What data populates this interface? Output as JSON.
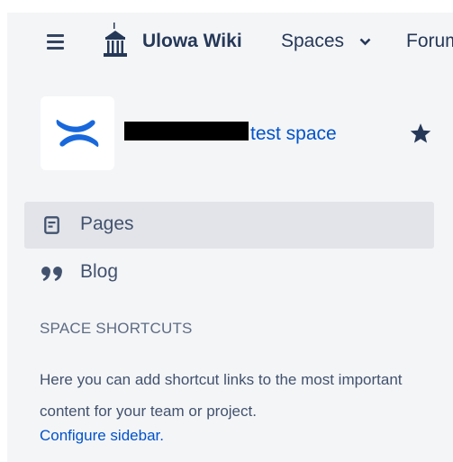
{
  "header": {
    "menu_icon": "hamburger-icon",
    "logo_icon": "building-logo-icon",
    "brand": "Ulowa Wiki",
    "nav": {
      "spaces": "Spaces",
      "spaces_icon": "chevron-down-icon",
      "forum": "Forum"
    }
  },
  "space": {
    "logo_icon": "confluence-logo-icon",
    "name": "test space",
    "star_icon": "star-icon"
  },
  "sidebar": {
    "items": [
      {
        "label": "Pages",
        "icon": "page-icon",
        "active": true
      },
      {
        "label": "Blog",
        "icon": "quote-icon",
        "active": false
      }
    ],
    "shortcuts_heading": "SPACE SHORTCUTS",
    "shortcuts_description": "Here you can add shortcut links to the most important content for your team or project.",
    "configure_link": "Configure sidebar."
  },
  "colors": {
    "accent": "#0052cc",
    "logo_blue": "#1868db",
    "sidebar_bg": "#f4f5f7",
    "active_bg": "#e2e4e9"
  }
}
